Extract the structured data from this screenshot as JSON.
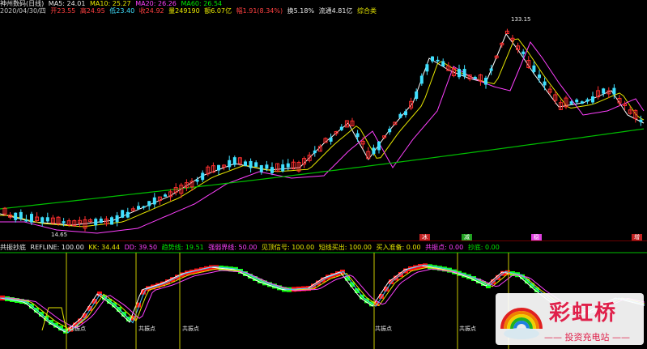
{
  "header": {
    "title": "神州数码(日线)",
    "ma5": "MA5: 24.01",
    "ma10": "MA10: 25.27",
    "ma20": "MA20: 26.26",
    "ma60": "MA60: 26.54",
    "date": "2020/04/30/四",
    "open": "开23.55",
    "high": "高24.95",
    "low": "低23.40",
    "close": "收24.92",
    "volume": "量249190",
    "amount": "额6.07亿",
    "change": "幅1.91(8.34%)",
    "turnover": "换5.18%",
    "float_cap": "流通4.81亿",
    "category": "综合类"
  },
  "price_labels": {
    "high_mark": "133.15",
    "low_mark": "14.65"
  },
  "indicator": {
    "name": "共振抄底",
    "refline": "REFLINE: 100.00",
    "kk": "KK: 34.44",
    "dd": "DD: 39.50",
    "trend": "趋势线: 19.51",
    "strong_weak": "强弱界线: 50.00",
    "overbought": "见顶信号: 100.00",
    "short_buy": "短线买出: 100.00",
    "buy_ready": "买入准备: 0.00",
    "resonance": "共振点: 0.00",
    "bottom": "抄底: 0.00"
  },
  "signal_labels": [
    "共振点",
    "共振点",
    "共振点",
    "共振点",
    "共振点"
  ],
  "markers": [
    "冰",
    "减",
    "稳",
    "增"
  ],
  "logo": {
    "name": "彩虹桥",
    "sub": "—— 投资充电站 ——"
  },
  "colors": {
    "up": "#ff3030",
    "down": "#40e0ff",
    "ma5": "#ffffff",
    "ma10": "#e8e800",
    "ma20": "#ff40ff",
    "ma60": "#00c000"
  }
}
